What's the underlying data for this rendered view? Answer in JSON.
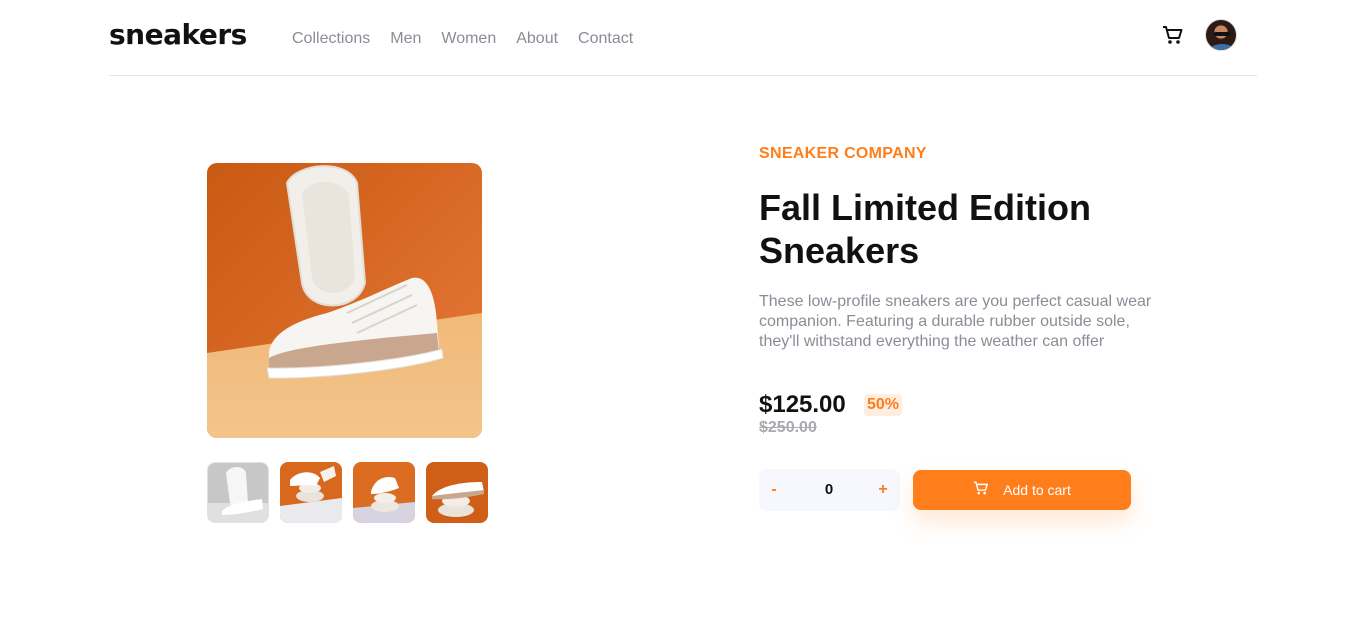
{
  "header": {
    "logo": "sneakers",
    "nav": [
      "Collections",
      "Men",
      "Women",
      "About",
      "Contact"
    ],
    "cart_icon": "cart-icon",
    "avatar_icon": "avatar"
  },
  "gallery": {
    "thumbnail_count": 4,
    "active_thumbnail": 1
  },
  "product": {
    "company": "SNEAKER COMPANY",
    "title": "Fall Limited Edition Sneakers",
    "description": "These low-profile sneakers are you perfect casual wear companion. Featuring a durable rubber outside sole, they'll withstand everything the weather can offer",
    "price": "$125.00",
    "discount": "50%",
    "old_price": "$250.00"
  },
  "cart": {
    "minus_label": "-",
    "quantity": "0",
    "plus_label": "+",
    "add_label": "Add to cart"
  },
  "colors": {
    "accent": "#ff7e1b",
    "accent_light": "#ffede0",
    "text_muted": "#8a8d96",
    "qty_bg": "#f6f8fd"
  }
}
